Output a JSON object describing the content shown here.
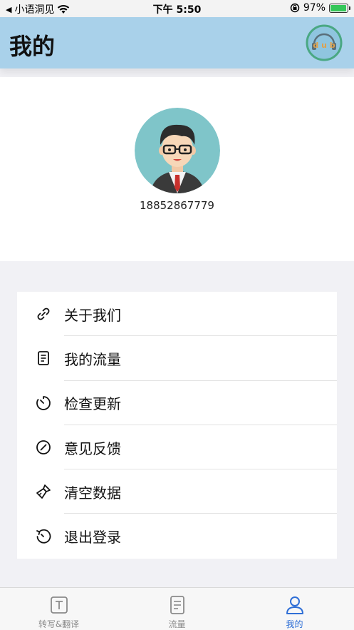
{
  "status_bar": {
    "back_app": "小语洞见",
    "time": "下午 5:50",
    "battery": "97%",
    "battery_level": 0.97
  },
  "header": {
    "title": "我的",
    "logo_text": "d u b"
  },
  "profile": {
    "phone": "18852867779"
  },
  "menu": {
    "items": [
      {
        "label": "关于我们",
        "icon": "link-icon"
      },
      {
        "label": "我的流量",
        "icon": "document-icon"
      },
      {
        "label": "检查更新",
        "icon": "timer-icon"
      },
      {
        "label": "意见反馈",
        "icon": "compass-icon"
      },
      {
        "label": "清空数据",
        "icon": "brush-icon"
      },
      {
        "label": "退出登录",
        "icon": "logout-icon"
      }
    ]
  },
  "tab_bar": {
    "tabs": [
      {
        "label": "转写&翻译",
        "icon": "text-icon",
        "active": false
      },
      {
        "label": "流量",
        "icon": "document-icon",
        "active": false
      },
      {
        "label": "我的",
        "icon": "person-icon",
        "active": true
      }
    ]
  },
  "colors": {
    "header_bg": "#a9d1ea",
    "accent": "#2f6fd6",
    "page_bg": "#f1f1f5"
  }
}
